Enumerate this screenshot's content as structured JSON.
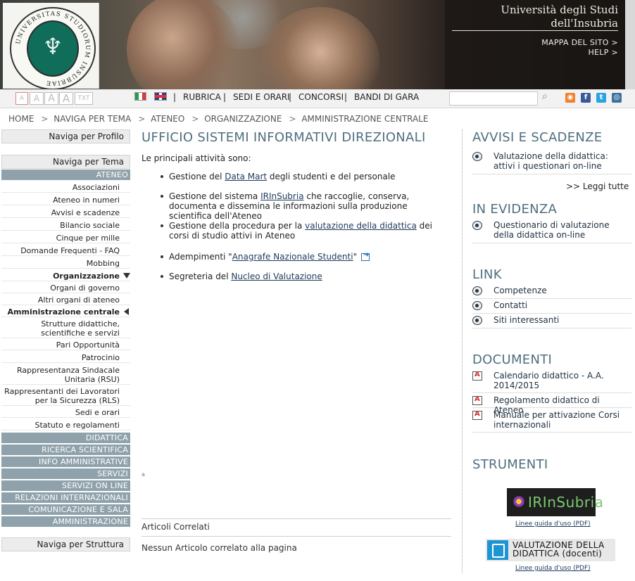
{
  "header": {
    "university_name_line1": "Università degli Studi",
    "university_name_line2": "dell'Insubria",
    "mappa_link": "MAPPA DEL SITO >",
    "help_link": "HELP >",
    "seal_text": "UNIVERSITAS STUDIORUM INSUBRIAE"
  },
  "toolbar": {
    "font_sizes": [
      "A",
      "A",
      "A",
      "A",
      "TXT"
    ],
    "nav": [
      "RUBRICA",
      "SEDI E ORARI",
      "CONCORSI",
      "BANDI DI GARA"
    ],
    "separator": "|",
    "search_placeholder": ""
  },
  "breadcrumb": [
    "HOME",
    "NAVIGA PER TEMA",
    "ATENEO",
    "ORGANIZZAZIONE",
    "AMMINISTRAZIONE CENTRALE"
  ],
  "breadcrumb_sep": ">",
  "sidebar": {
    "profilo": "Naviga per Profilo",
    "tema": "Naviga per Tema",
    "struttura": "Naviga per Struttura",
    "ateneo": "ATENEO",
    "ateneo_items": [
      "Associazioni",
      "Ateneo in numeri",
      "Avvisi e scadenze",
      "Bilancio sociale",
      "Cinque per mille",
      "Domande Frequenti - FAQ",
      "Mobbing"
    ],
    "organizzazione": "Organizzazione",
    "org_items": [
      "Organi di governo",
      "Altri organi di ateneo"
    ],
    "amministrazione": "Amministrazione centrale",
    "after_items": [
      "Strutture didattiche, scientifiche e servizi",
      "Pari Opportunità",
      "Patrocinio",
      "Rappresentanza Sindacale Unitaria (RSU)",
      "Rappresentanti dei Lavoratori per la Sicurezza (RLS)",
      "Sedi e orari",
      "Statuto e regolamenti"
    ],
    "categories": [
      "DIDATTICA",
      "RICERCA SCIENTIFICA",
      "INFO AMMINISTRATIVE",
      "SERVIZI",
      "SERVIZI ON LINE",
      "RELAZIONI INTERNAZIONALI",
      "COMUNICAZIONE E SALA STAMPA",
      "AMMINISTRAZIONE TRASPARENTE"
    ]
  },
  "main": {
    "title": "UFFICIO SISTEMI INFORMATIVI DIREZIONALI",
    "intro": "Le principali attività sono:",
    "a1_pre": "Gestione del ",
    "a1_link": "Data Mart",
    "a1_post": " degli studenti e del personale",
    "a2_pre": "Gestione del sistema ",
    "a2_link": "IRInSubria",
    "a2_post": " che raccoglie, conserva, documenta e dissemina le informazioni sulla produzione scientifica dell'Ateneo",
    "a3_pre": "Gestione della procedura per la ",
    "a3_link": "valutazione della didattica",
    "a3_post": " dei corsi di studio attivi in Ateneo",
    "a4_pre": "Adempimenti \"",
    "a4_link": "Anagrafe Nazionale Studenti",
    "a4_post": "\"",
    "a5_pre": "Segreteria del ",
    "a5_link": "Nucleo di Valutazione",
    "tiny_mark": "a",
    "correlati_title": "Articoli Correlati",
    "correlati_empty": "Nessun Articolo correlato alla pagina"
  },
  "right": {
    "avvisi_title": "AVVISI E SCADENZE",
    "avvisi_items": [
      "Valutazione della didattica: attivi i questionari on-line"
    ],
    "leggi_tutte": ">> Leggi tutte",
    "evidenza_title": "IN EVIDENZA",
    "evidenza_items": [
      "Questionario di valutazione della didattica on-line"
    ],
    "link_title": "LINK",
    "link_items": [
      "Competenze",
      "Contatti",
      "Siti interessanti"
    ],
    "documenti_title": "DOCUMENTI",
    "documenti_items": [
      "Calendario didattico - A.A. 2014/2015",
      "Regolamento didattico di Ateneo",
      "Manuale per attivazione Corsi internazionali"
    ],
    "strumenti_title": "STRUMENTI",
    "irin_logo": "IRInSubria",
    "irin_guide": "Linee guida d'uso (PDF)",
    "val_logo_line1": "VALUTAZIONE DELLA",
    "val_logo_line2": "DIDATTICA (docenti)",
    "val_guide": "Linee guida d'uso (PDF)"
  },
  "social": {
    "rss": "rss-icon",
    "facebook": "facebook-icon",
    "twitter": "twitter-icon",
    "instagram": "instagram-icon",
    "colors": {
      "rss": "#f0822f",
      "facebook": "#3b5998",
      "twitter": "#2aa3e3",
      "instagram": "#3e729a"
    }
  }
}
